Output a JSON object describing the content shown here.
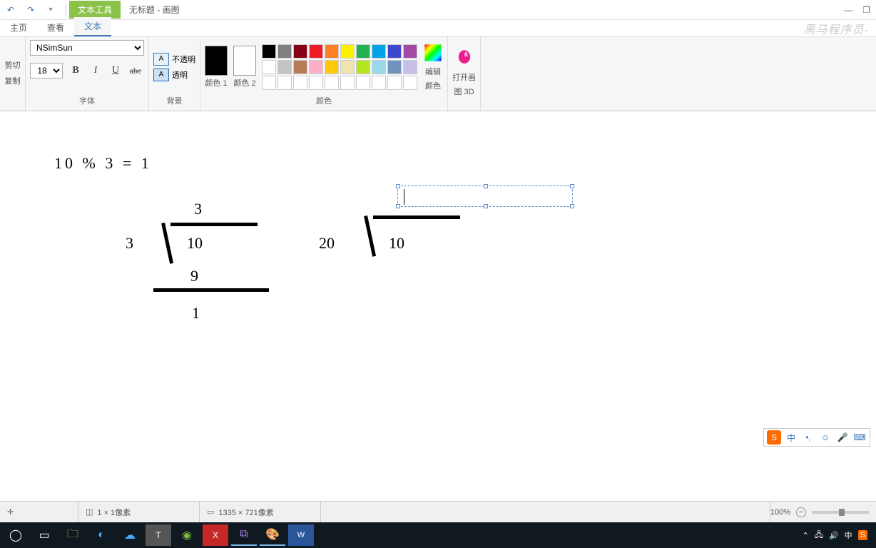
{
  "titlebar": {
    "contextual_tab": "文本工具",
    "title": "无标题 - 画图",
    "minimize": "—",
    "maximize": "❐"
  },
  "tabs": {
    "home": "主页",
    "view": "查看",
    "text": "文本"
  },
  "ribbon": {
    "clipboard": {
      "cut": "剪切",
      "copy": "复制"
    },
    "font": {
      "family": "NSimSun",
      "size": "18",
      "label": "字体"
    },
    "background": {
      "opaque": "不透明",
      "transparent": "透明",
      "label": "背景"
    },
    "colors": {
      "color1_label": "颜色 1",
      "color2_label": "颜色 2",
      "edit_label1": "编辑",
      "edit_label2": "颜色",
      "group_label": "颜色"
    },
    "paint3d": {
      "label1": "打开画",
      "label2": "图 3D"
    }
  },
  "canvas": {
    "equation": "10 % 3 = 1",
    "div1_quotient": "3",
    "div1_divisor": "3",
    "div1_dividend": "10",
    "div1_sub": "9",
    "div1_remainder": "1",
    "div2_divisor": "20",
    "div2_dividend": "10"
  },
  "statusbar": {
    "pointer": "1 × 1像素",
    "canvas_size": "1335 × 721像素",
    "zoom": "100%"
  },
  "watermark": "黑马程序员-",
  "ime": {
    "s_logo": "S",
    "zhong": "中"
  },
  "palette_colors": [
    "#000",
    "#7f7f7f",
    "#880015",
    "#ed1c24",
    "#ff7f27",
    "#fff200",
    "#22b14c",
    "#00a2e8",
    "#3f48cc",
    "#a349a4",
    "#fff",
    "#c3c3c3",
    "#b97a57",
    "#ffaec9",
    "#ffc90e",
    "#efe4b0",
    "#b5e61d",
    "#99d9ea",
    "#7092be",
    "#c8bfe7",
    "#fff",
    "#fff",
    "#fff",
    "#fff",
    "#fff",
    "#fff",
    "#fff",
    "#fff",
    "#fff",
    "#fff"
  ]
}
